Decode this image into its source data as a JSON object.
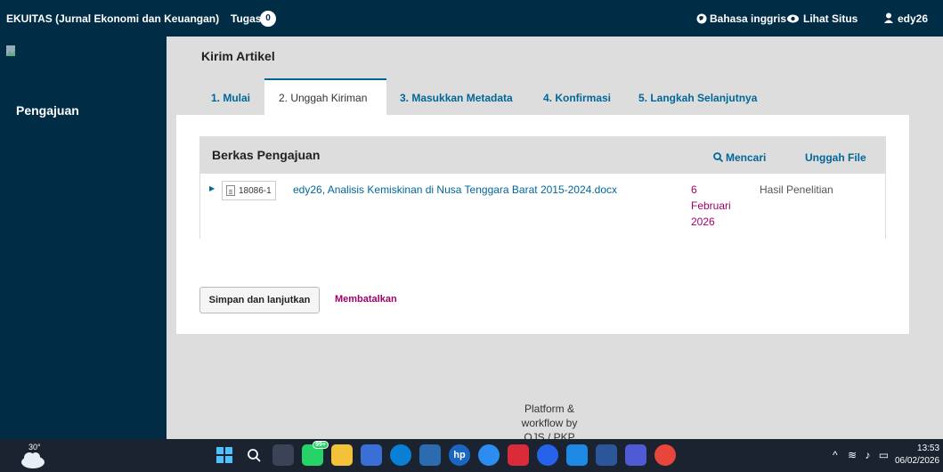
{
  "topbar": {
    "journal_name": "EKUITAS (Jurnal Ekonomi dan Keuangan)",
    "tasks_label": "Tugas",
    "tasks_count": "0",
    "language_label": "Bahasa inggris",
    "view_site_label": "Lihat Situs",
    "user_label": "edy26"
  },
  "sidebar": {
    "nav_label": "Pengajuan"
  },
  "main": {
    "page_title": "Kirim Artikel",
    "tabs": [
      {
        "label": "1. Mulai"
      },
      {
        "label": "2. Unggah Kiriman"
      },
      {
        "label": "3. Masukkan Metadata"
      },
      {
        "label": "4. Konfirmasi"
      },
      {
        "label": "5. Langkah Selanjutnya"
      }
    ],
    "files": {
      "title": "Berkas Pengajuan",
      "search_label": "Mencari",
      "upload_label": "Unggah File",
      "rows": [
        {
          "id": "18086-1",
          "name": "edy26, Analisis Kemiskinan di Nusa Tenggara Barat 2015-2024.docx",
          "date_line1": "6",
          "date_line2": "Februari",
          "date_line3": "2026",
          "type": "Hasil Penelitian"
        }
      ]
    },
    "save_label": "Simpan dan lanjutkan",
    "cancel_label": "Membatalkan"
  },
  "footer": {
    "line1": "Platform &",
    "line2": "workflow by",
    "line3": "OJS / PKP"
  },
  "taskbar": {
    "temperature": "30°",
    "chat_badge": "99+",
    "time": "13:53",
    "date": "06/02/2026"
  },
  "colors": {
    "navy": "#002d45",
    "link_blue": "#006798",
    "magenta": "#a00069",
    "taskbar": "#1b2330"
  }
}
